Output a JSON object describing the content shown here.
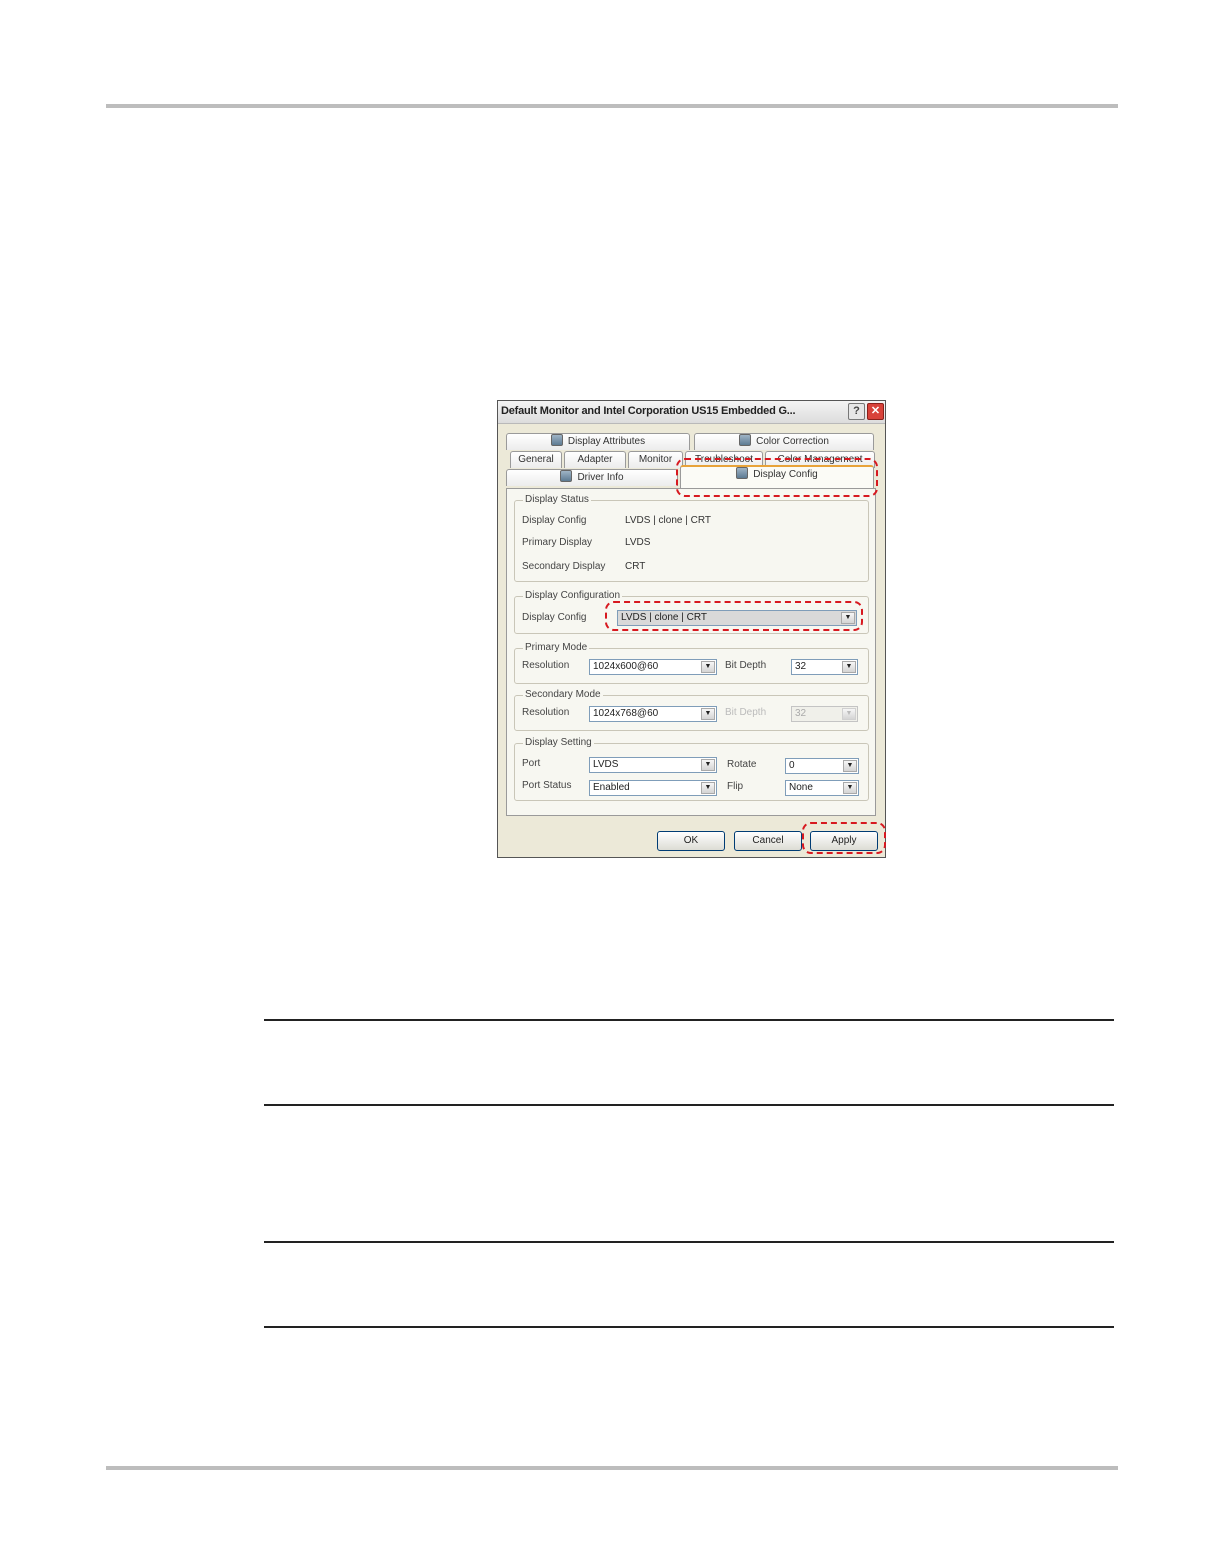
{
  "dialog": {
    "title": "Default Monitor and Intel Corporation US15 Embedded G...",
    "help_label": "?",
    "close_label": "✕",
    "tabs_row1": [
      {
        "label": "Display Attributes",
        "icon": "display-settings-icon"
      },
      {
        "label": "Color Correction",
        "icon": "display-settings-icon"
      }
    ],
    "tabs_row2": [
      "General",
      "Adapter",
      "Monitor",
      "Troubleshoot",
      "Color Management"
    ],
    "tabs_row3": [
      {
        "label": "Driver Info",
        "icon": "display-settings-icon"
      },
      {
        "label": "Display Config",
        "icon": "display-settings-icon",
        "active": true
      }
    ],
    "display_status": {
      "title": "Display Status",
      "rows": [
        {
          "label": "Display Config",
          "value": "LVDS | clone | CRT"
        },
        {
          "label": "Primary Display",
          "value": "LVDS"
        },
        {
          "label": "Secondary Display",
          "value": "CRT"
        }
      ]
    },
    "display_configuration": {
      "title": "Display Configuration",
      "label": "Display Config",
      "value": "LVDS | clone | CRT"
    },
    "primary_mode": {
      "title": "Primary Mode",
      "resolution_label": "Resolution",
      "resolution_value": "1024x600@60",
      "bitdepth_label": "Bit Depth",
      "bitdepth_value": "32"
    },
    "secondary_mode": {
      "title": "Secondary Mode",
      "resolution_label": "Resolution",
      "resolution_value": "1024x768@60",
      "bitdepth_label": "Bit Depth",
      "bitdepth_value": "32"
    },
    "display_setting": {
      "title": "Display Setting",
      "port_label": "Port",
      "port_value": "LVDS",
      "rotate_label": "Rotate",
      "rotate_value": "0",
      "port_status_label": "Port Status",
      "port_status_value": "Enabled",
      "flip_label": "Flip",
      "flip_value": "None"
    },
    "buttons": {
      "ok": "OK",
      "cancel": "Cancel",
      "apply": "Apply"
    },
    "dropdown_arrow": "▼",
    "highlight_color": "#d71920"
  }
}
